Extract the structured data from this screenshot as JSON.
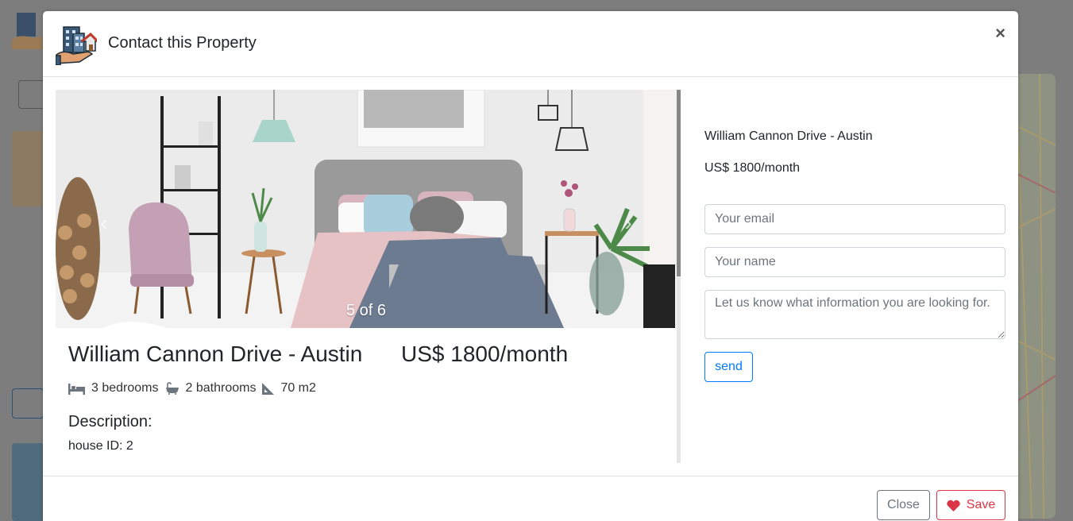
{
  "modal": {
    "title": "Contact this Property",
    "close_symbol": "×"
  },
  "carousel": {
    "counter": "5 of 6",
    "prev_icon": "chevron-left-icon",
    "next_icon": "chevron-right-icon"
  },
  "property": {
    "title": "William Cannon Drive - Austin",
    "price": "US$ 1800/month",
    "features": [
      {
        "icon": "bed-icon",
        "label": "3 bedrooms"
      },
      {
        "icon": "bath-icon",
        "label": "2 bathrooms"
      },
      {
        "icon": "ruler-triangle-icon",
        "label": "70 m2"
      }
    ],
    "description_heading": "Description:",
    "house_id": "house ID: 2"
  },
  "contact_form": {
    "title": "William Cannon Drive - Austin",
    "price": "US$ 1800/month",
    "email_placeholder": "Your email",
    "name_placeholder": "Your name",
    "message_placeholder": "Let us know what information you are looking for.",
    "send_label": "send"
  },
  "footer": {
    "close_label": "Close",
    "save_label": "Save",
    "save_icon": "heart-icon"
  },
  "colors": {
    "primary": "#007bff",
    "danger": "#dc3545",
    "secondary": "#6c757d"
  }
}
